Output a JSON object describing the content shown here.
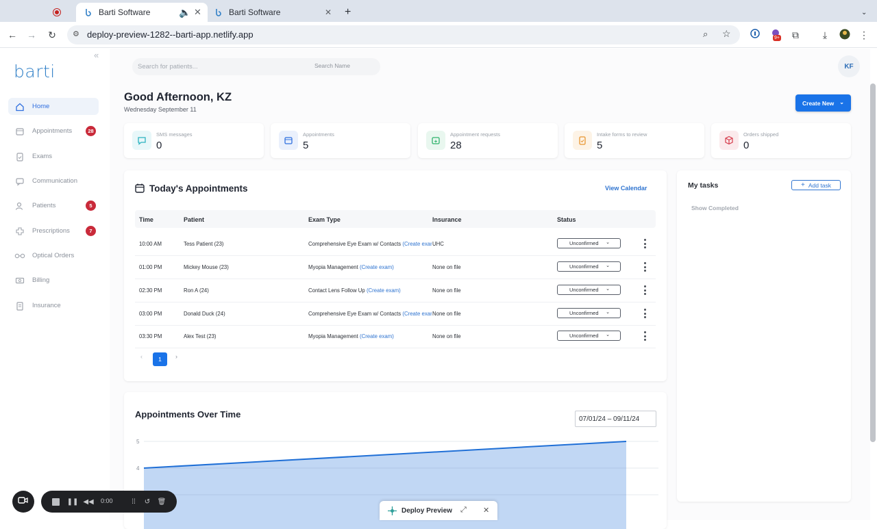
{
  "browser": {
    "tabs": [
      {
        "label": "",
        "icon": "record-icon"
      },
      {
        "label": "Barti Software",
        "active": true
      },
      {
        "label": "Barti Software",
        "active": false
      }
    ],
    "url": "deploy-preview-1282--barti-app.netlify.app",
    "ext_badge": "9+"
  },
  "sidebar": {
    "logo": "barti",
    "items": [
      {
        "label": "Home",
        "icon": "home-icon",
        "active": true,
        "badge": ""
      },
      {
        "label": "Appointments",
        "icon": "calendar-icon",
        "badge": "28"
      },
      {
        "label": "Exams",
        "icon": "clipboard-icon",
        "badge": ""
      },
      {
        "label": "Communication",
        "icon": "chat-icon",
        "badge": ""
      },
      {
        "label": "Patients",
        "icon": "users-icon",
        "badge": "5"
      },
      {
        "label": "Prescriptions",
        "icon": "prescription-icon",
        "badge": "7"
      },
      {
        "label": "Optical Orders",
        "icon": "glasses-icon",
        "badge": ""
      },
      {
        "label": "Billing",
        "icon": "billing-icon",
        "badge": ""
      },
      {
        "label": "Insurance",
        "icon": "insurance-icon",
        "badge": ""
      }
    ]
  },
  "header": {
    "search_placeholder": "Search for patients...",
    "search_mode": "Search Name",
    "avatar_initials": "KF",
    "greeting": "Good Afternoon, KZ",
    "date": "Wednesday September 11",
    "create_label": "Create New"
  },
  "stats": [
    {
      "label": "SMS messages",
      "value": "0",
      "color": "#2bb3c0"
    },
    {
      "label": "Appointments",
      "value": "5",
      "color": "#2f6fdf"
    },
    {
      "label": "Appointment requests",
      "value": "28",
      "color": "#2fb36b"
    },
    {
      "label": "Intake forms to review",
      "value": "5",
      "color": "#e89530"
    },
    {
      "label": "Orders shipped",
      "value": "0",
      "color": "#d63a4a"
    }
  ],
  "appointments": {
    "title": "Today's Appointments",
    "view_calendar": "View Calendar",
    "columns": [
      "Time",
      "Patient",
      "Exam Type",
      "Insurance",
      "Status"
    ],
    "create_exam": "(Create exam)",
    "rows": [
      {
        "time": "10:00 AM",
        "patient": "Tess Patient (23)",
        "exam": "Comprehensive Eye Exam w/ Contacts",
        "insurance": "UHC",
        "status": "Unconfirmed"
      },
      {
        "time": "01:00 PM",
        "patient": "Mickey Mouse (23)",
        "exam": "Myopia Management",
        "insurance": "None on file",
        "status": "Unconfirmed"
      },
      {
        "time": "02:30 PM",
        "patient": "Ron A (24)",
        "exam": "Contact Lens Follow Up",
        "insurance": "None on file",
        "status": "Unconfirmed"
      },
      {
        "time": "03:00 PM",
        "patient": "Donald Duck (24)",
        "exam": "Comprehensive Eye Exam w/ Contacts",
        "insurance": "None on file",
        "status": "Unconfirmed"
      },
      {
        "time": "03:30 PM",
        "patient": "Alex Test (23)",
        "exam": "Myopia Management",
        "insurance": "None on file",
        "status": "Unconfirmed"
      }
    ],
    "current_page": "1"
  },
  "tasks": {
    "title": "My tasks",
    "add_label": "Add task",
    "show_completed": "Show Completed"
  },
  "chart": {
    "title": "Appointments Over Time",
    "date_range": "07/01/24 – 09/11/24"
  },
  "chart_data": {
    "type": "area",
    "title": "Appointments Over Time",
    "xlabel": "",
    "ylabel": "",
    "ylim": [
      3,
      5
    ],
    "yticks": [
      "5",
      "4",
      "3"
    ],
    "series": [
      {
        "values": [
          4,
          5
        ]
      }
    ],
    "color": "#1f6fd6"
  },
  "recorder": {
    "time": "0:00"
  },
  "deploy": {
    "label": "Deploy Preview"
  }
}
